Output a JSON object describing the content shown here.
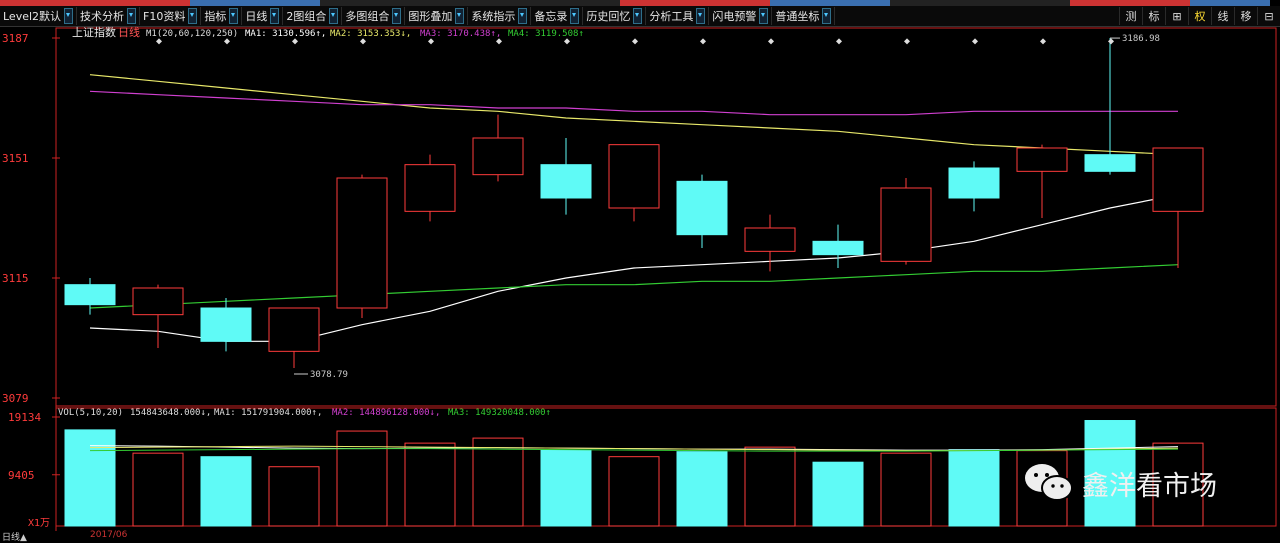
{
  "toolbar": {
    "items": [
      {
        "label": "Level2默认"
      },
      {
        "label": "技术分析"
      },
      {
        "label": "F10资料"
      },
      {
        "label": "指标"
      },
      {
        "label": "日线"
      },
      {
        "label": "2图组合"
      },
      {
        "label": "多图组合"
      },
      {
        "label": "图形叠加"
      },
      {
        "label": "系统指示"
      },
      {
        "label": "备忘录"
      },
      {
        "label": "历史回忆"
      },
      {
        "label": "分析工具"
      },
      {
        "label": "闪电预警"
      },
      {
        "label": "普通坐标"
      }
    ],
    "right_buttons": [
      "测",
      "标",
      "⊞",
      "权",
      "线",
      "移",
      "⊟"
    ],
    "active_right": "权"
  },
  "main": {
    "title": "上证指数",
    "period": "日线",
    "ma_params": "M1(20,60,120,250)",
    "ma1": "MA1: 3130.596↑,",
    "ma2": "MA2: 3153.353↓,",
    "ma3": "MA3: 3170.438↑,",
    "ma4": "MA4: 3119.508↑",
    "axis_labels": [
      "3187",
      "3151",
      "3115",
      "3079"
    ],
    "high_label": "3186.98",
    "low_label": "3078.79"
  },
  "volume": {
    "params": "VOL(5,10,20)",
    "vol": "154843648.000↓,",
    "ma1": "MA1: 151791904.000↑,",
    "ma2": "MA2: 144896128.000↓,",
    "ma3": "MA3: 149320048.000↑",
    "axis_labels": [
      "19134",
      "9405"
    ],
    "unit": "X1万"
  },
  "footer": {
    "label": "日线▲",
    "date": "2017/06"
  },
  "watermark": "鑫洋看市场",
  "colors": {
    "up": "#ff3b3b",
    "down": "#5ffaf6",
    "ma1": "#ffffff",
    "ma2": "#e8e86a",
    "ma3": "#d040d0",
    "ma4": "#33cc33",
    "axis": "#cc2222"
  },
  "chart_data": {
    "type": "candlestick",
    "ylim": [
      3079,
      3187
    ],
    "candles": [
      {
        "o": 3113,
        "c": 3107,
        "h": 3115,
        "l": 3104
      },
      {
        "o": 3104,
        "c": 3112,
        "h": 3113,
        "l": 3094
      },
      {
        "o": 3106,
        "c": 3096,
        "h": 3109,
        "l": 3093
      },
      {
        "o": 3093,
        "c": 3106,
        "h": 3106,
        "l": 3088
      },
      {
        "o": 3106,
        "c": 3145,
        "h": 3146,
        "l": 3103
      },
      {
        "o": 3135,
        "c": 3149,
        "h": 3152,
        "l": 3132
      },
      {
        "o": 3146,
        "c": 3157,
        "h": 3164,
        "l": 3144
      },
      {
        "o": 3149,
        "c": 3139,
        "h": 3157,
        "l": 3134
      },
      {
        "o": 3136,
        "c": 3155,
        "h": 3154,
        "l": 3132
      },
      {
        "o": 3144,
        "c": 3128,
        "h": 3146,
        "l": 3124
      },
      {
        "o": 3123,
        "c": 3130,
        "h": 3134,
        "l": 3117
      },
      {
        "o": 3126,
        "c": 3122,
        "h": 3131,
        "l": 3118
      },
      {
        "o": 3120,
        "c": 3142,
        "h": 3145,
        "l": 3119
      },
      {
        "o": 3148,
        "c": 3139,
        "h": 3150,
        "l": 3135
      },
      {
        "o": 3147,
        "c": 3154,
        "h": 3155,
        "l": 3133
      },
      {
        "o": 3152,
        "c": 3147,
        "h": 3186.98,
        "l": 3146
      },
      {
        "o": 3135,
        "c": 3154,
        "h": 3135,
        "l": 3118
      }
    ],
    "ma_lines": [
      {
        "name": "MA1",
        "values": [
          3100,
          3099,
          3096,
          3096,
          3101,
          3105,
          3111,
          3115,
          3118,
          3119,
          3120,
          3121,
          3123,
          3126,
          3131,
          3136,
          3140
        ]
      },
      {
        "name": "MA2",
        "values": [
          3176,
          3174,
          3172,
          3170,
          3168,
          3166,
          3165,
          3163,
          3162,
          3161,
          3160,
          3159,
          3157,
          3155,
          3154,
          3153,
          3152
        ]
      },
      {
        "name": "MA3",
        "values": [
          3171,
          3170,
          3169,
          3168,
          3167,
          3167,
          3166,
          3166,
          3165,
          3165,
          3164,
          3164,
          3164,
          3165,
          3165,
          3165,
          3165
        ]
      },
      {
        "name": "MA4",
        "values": [
          3106,
          3107,
          3108,
          3109,
          3110,
          3111,
          3112,
          3113,
          3113,
          3114,
          3114,
          3115,
          3116,
          3117,
          3117,
          3118,
          3119
        ]
      }
    ],
    "volume": [
      19134,
      14500,
      13800,
      11800,
      18900,
      16500,
      17500,
      15100,
      13800,
      14800,
      15700,
      12700,
      14500,
      15200,
      15000,
      21000,
      16500
    ],
    "vol_ylim": [
      0,
      21500
    ]
  }
}
